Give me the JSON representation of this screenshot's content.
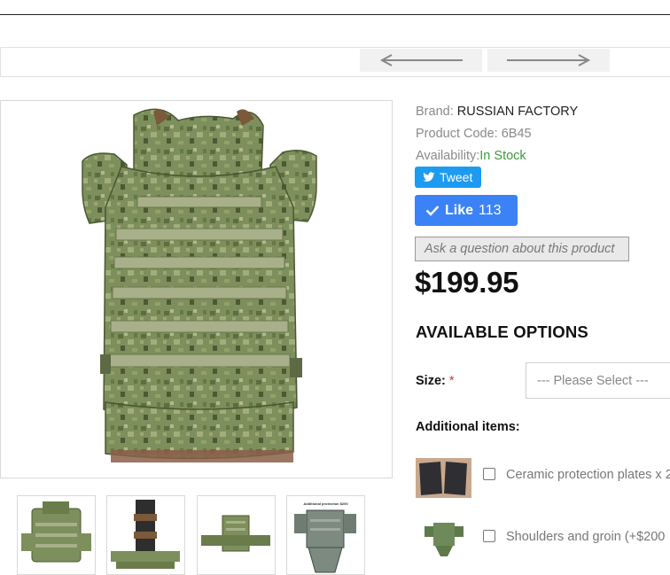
{
  "nav": {
    "prev_icon": "arrow-left-icon",
    "next_icon": "arrow-right-icon"
  },
  "product": {
    "brand_label": "Brand: ",
    "brand": "RUSSIAN FACTORY",
    "code_label": "Product Code: ",
    "code": "6B45",
    "availability_label": "Availability:",
    "availability": "In Stock",
    "price": "$199.95"
  },
  "social": {
    "tweet_label": "Tweet",
    "like_label": "Like",
    "like_count": "113"
  },
  "ask_label": "Ask a question about this product",
  "options": {
    "heading": "AVAILABLE OPTIONS",
    "size_label": "Size:",
    "required_mark": "*",
    "size_placeholder": "--- Please Select ---",
    "additional_label": "Additional items:",
    "items": [
      {
        "label": "Ceramic protection plates x 2",
        "checked": false
      },
      {
        "label": "Shoulders and groin (+$200",
        "checked": false
      }
    ]
  },
  "thumbnails": [
    {
      "caption": ""
    },
    {
      "caption": ""
    },
    {
      "caption": ""
    },
    {
      "caption": "Additional protection $200"
    }
  ],
  "colors": {
    "tweet": "#1d9bf0",
    "like": "#3b82f6",
    "in_stock": "#3e9a3e",
    "required": "#d9302c"
  }
}
